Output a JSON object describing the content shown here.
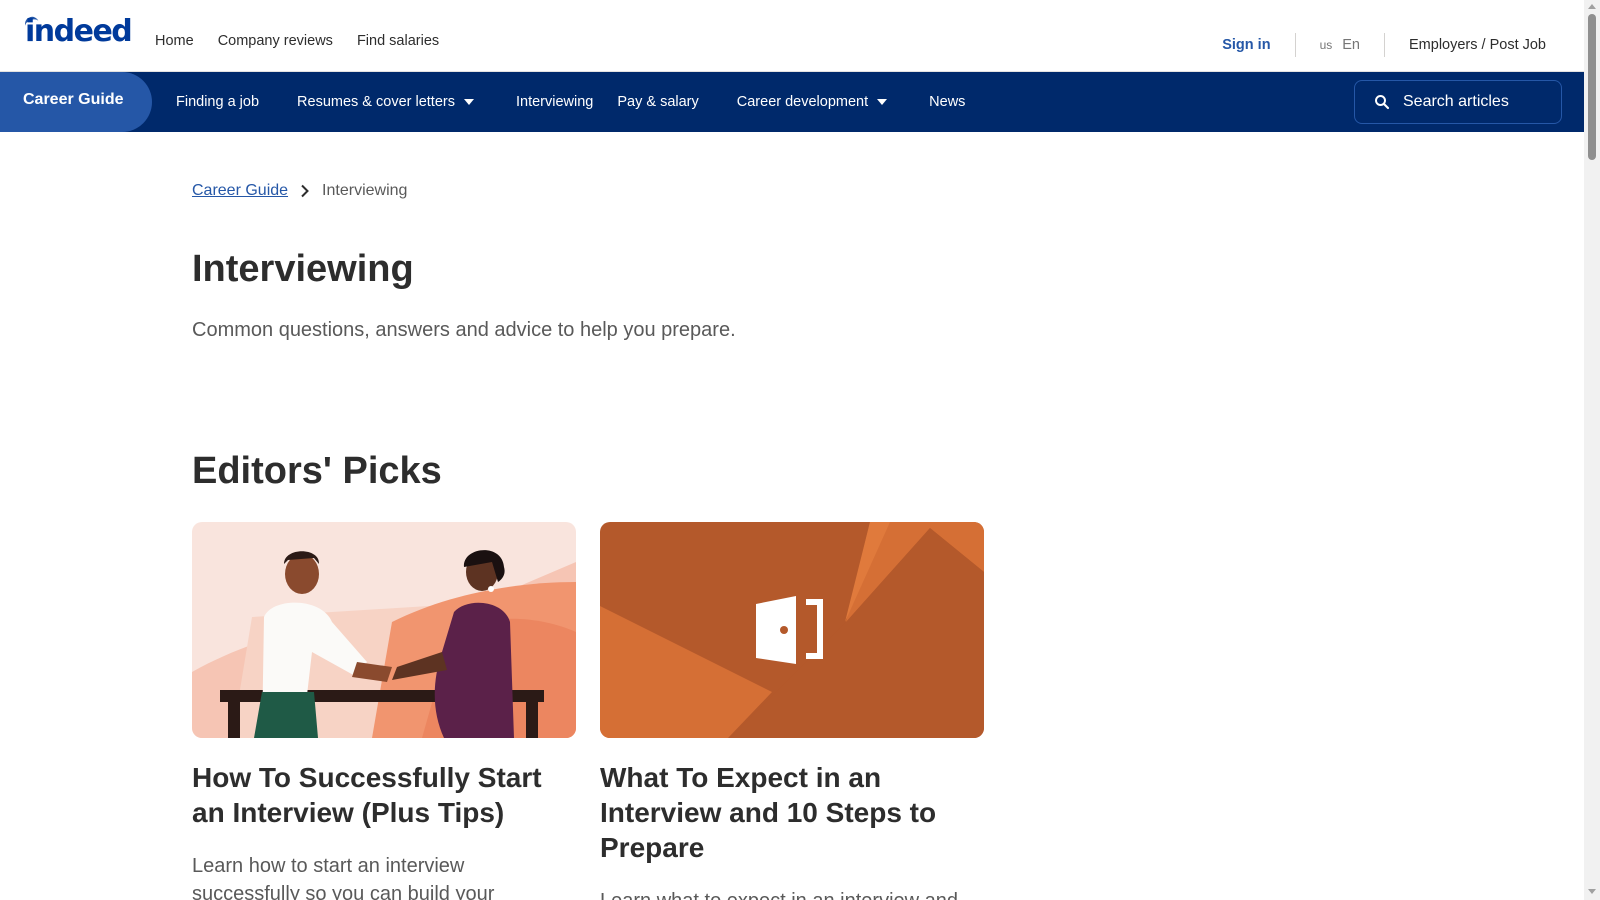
{
  "header": {
    "logo_text": "indeed",
    "nav": [
      "Home",
      "Company reviews",
      "Find salaries"
    ],
    "sign_in": "Sign in",
    "country": "us",
    "language": "En",
    "employers": "Employers / Post Job"
  },
  "navbar": {
    "brand": "Career Guide",
    "links": [
      {
        "label": "Finding a job",
        "dropdown": false
      },
      {
        "label": "Resumes & cover letters",
        "dropdown": true
      },
      {
        "label": "Interviewing",
        "dropdown": false
      },
      {
        "label": "Pay & salary",
        "dropdown": false
      },
      {
        "label": "Career development",
        "dropdown": true
      },
      {
        "label": "News",
        "dropdown": false
      }
    ],
    "search_placeholder": "Search articles"
  },
  "breadcrumb": {
    "root": "Career Guide",
    "current": "Interviewing"
  },
  "page": {
    "title": "Interviewing",
    "subtitle": "Common questions, answers and advice to help you prepare."
  },
  "editors_picks": {
    "heading": "Editors' Picks",
    "cards": [
      {
        "title": "How To Successfully Start an Interview (Plus Tips)",
        "description": "Learn how to start an interview successfully so you can build your",
        "image": "handshake-illustration"
      },
      {
        "title": "What To Expect in an Interview and 10 Steps to Prepare",
        "description": "Learn what to expect in an interview and",
        "image": "door-icon-illustration"
      }
    ]
  },
  "colors": {
    "brand_blue": "#2557a7",
    "navbar_navy": "#00296b",
    "text_dark": "#2d2d2d",
    "text_muted": "#595959"
  }
}
